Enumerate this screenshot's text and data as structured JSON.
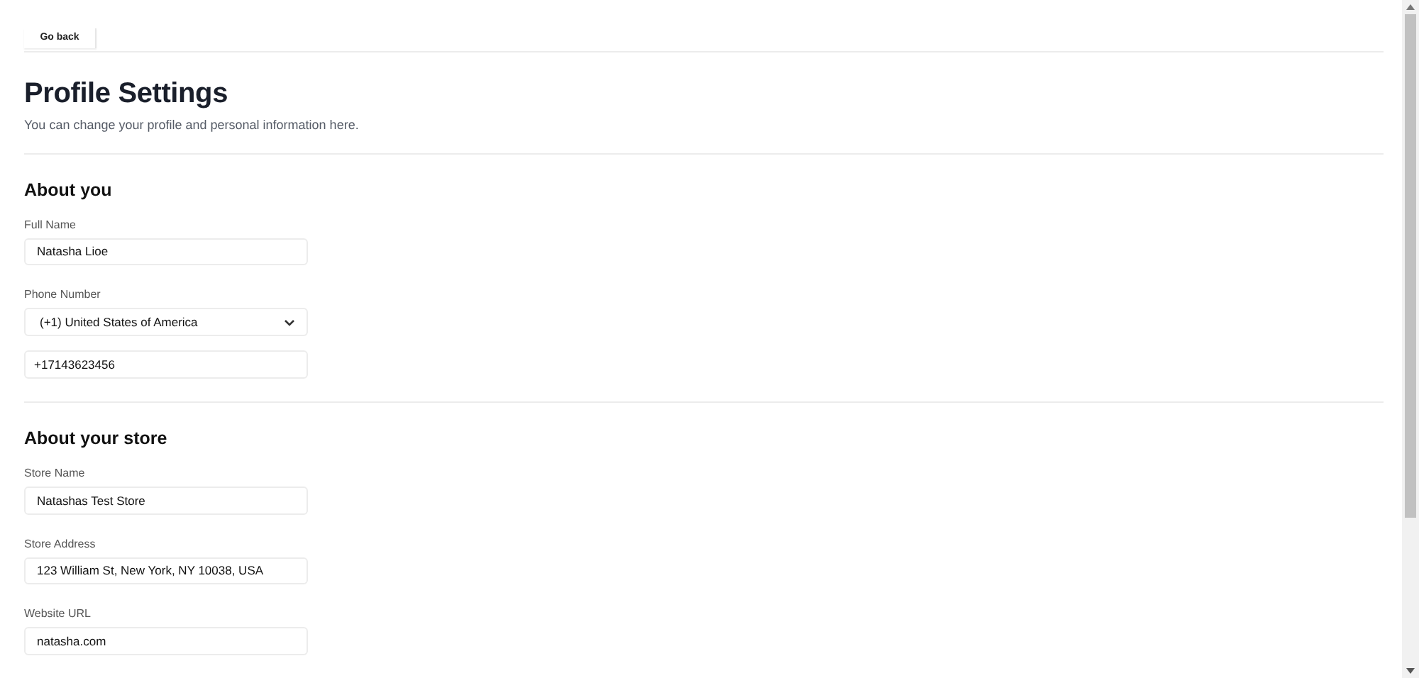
{
  "back_button": {
    "label": "Go back"
  },
  "header": {
    "title": "Profile Settings",
    "subtitle": "You can change your profile and personal information here."
  },
  "sections": [
    {
      "title": "About you",
      "fields": [
        {
          "kind": "text",
          "label": "Full Name",
          "value": "Natasha Lioe"
        },
        {
          "kind": "select",
          "label": "Phone Number",
          "value": "(+1) United States of America"
        },
        {
          "kind": "text",
          "value": "+17143623456"
        }
      ]
    },
    {
      "title": "About your store",
      "fields": [
        {
          "kind": "text",
          "label": "Store Name",
          "value": "Natashas Test Store"
        },
        {
          "kind": "text",
          "label": "Store Address",
          "value": "123 William St, New York, NY 10038, USA"
        },
        {
          "kind": "text",
          "label": "Website URL",
          "value": "natasha.com"
        }
      ]
    }
  ]
}
